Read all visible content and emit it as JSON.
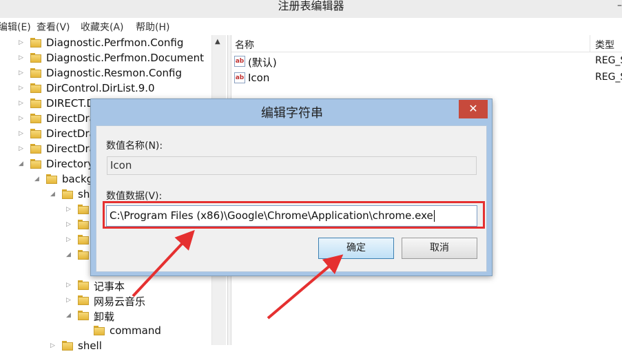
{
  "window": {
    "title": "注册表编辑器",
    "restore_glyph": "–"
  },
  "menu": [
    "编辑(E)",
    "查看(V)",
    "收藏夹(A)",
    "帮助(H)"
  ],
  "tree": [
    {
      "label": "Diagnostic.Perfmon.Config"
    },
    {
      "label": "Diagnostic.Perfmon.Document"
    },
    {
      "label": "Diagnostic.Resmon.Config"
    },
    {
      "label": "DirControl.DirList.9.0"
    },
    {
      "label": "DIRECT.D"
    },
    {
      "label": "DirectDra"
    },
    {
      "label": "DirectDra"
    },
    {
      "label": "DirectDra"
    },
    {
      "label": "Directory"
    },
    {
      "label": "backg"
    },
    {
      "label": "sh"
    },
    {
      "label": ""
    },
    {
      "label": ""
    },
    {
      "label": ""
    },
    {
      "label": ""
    },
    {
      "label": ""
    },
    {
      "label": "记事本"
    },
    {
      "label": "网易云音乐"
    },
    {
      "label": "卸载"
    },
    {
      "label": "command"
    },
    {
      "label": "shell"
    }
  ],
  "list": {
    "columns": {
      "name": "名称",
      "type": "类型"
    },
    "rows": [
      {
        "name": "(默认)",
        "type": "REG_S",
        "icon": "ab"
      },
      {
        "name": "Icon",
        "type": "REG_S",
        "icon": "ab"
      }
    ]
  },
  "dialog": {
    "title": "编辑字符串",
    "close": "✕",
    "value_name_label": "数值名称(N):",
    "value_name": "Icon",
    "value_data_label": "数值数据(V):",
    "value_data": "C:\\Program Files (x86)\\Google\\Chrome\\Application\\chrome.exe",
    "ok": "确定",
    "cancel": "取消"
  },
  "annotation_color": "#e53030"
}
